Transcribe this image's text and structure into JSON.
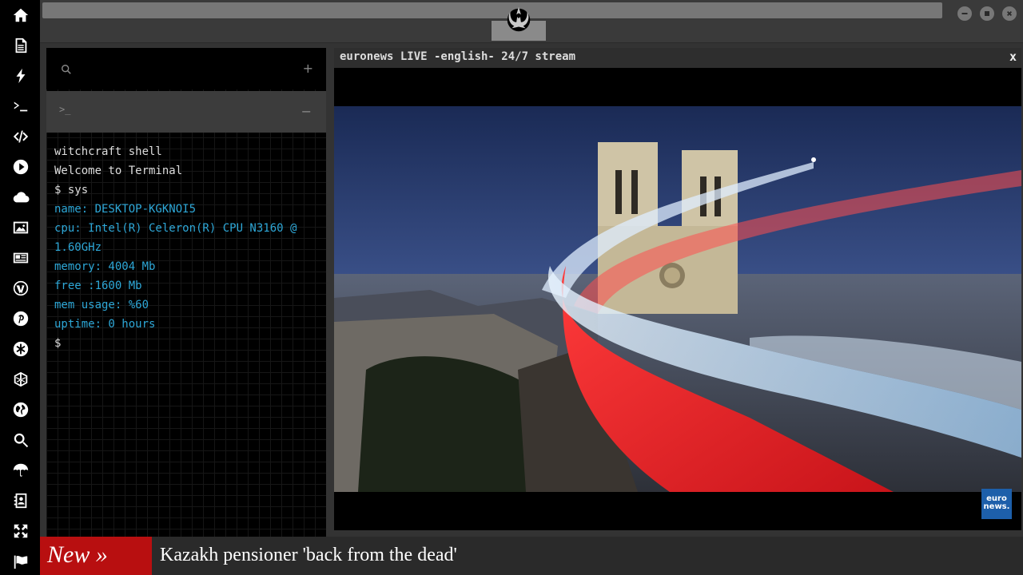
{
  "sidebar": {
    "items": [
      {
        "icon": "home-icon"
      },
      {
        "icon": "document-icon"
      },
      {
        "icon": "lightning-icon"
      },
      {
        "icon": "terminal-icon"
      },
      {
        "icon": "code-icon"
      },
      {
        "icon": "play-icon"
      },
      {
        "icon": "cloud-icon"
      },
      {
        "icon": "image-icon"
      },
      {
        "icon": "newspaper-icon"
      },
      {
        "icon": "wordpress-icon"
      },
      {
        "icon": "pinterest-icon"
      },
      {
        "icon": "snowflake-icon"
      },
      {
        "icon": "globe-mesh-icon"
      },
      {
        "icon": "globe-icon"
      },
      {
        "icon": "search-icon"
      },
      {
        "icon": "umbrella-icon"
      },
      {
        "icon": "contacts-icon"
      },
      {
        "icon": "expand-icon"
      },
      {
        "icon": "flag-icon"
      }
    ]
  },
  "topbar": {
    "logo": "rebel-alliance-icon",
    "buttons": [
      "minimize-icon",
      "maximize-icon",
      "close-icon"
    ]
  },
  "terminal": {
    "search_icon": "search-icon",
    "add_label": "+",
    "tab_prompt": ">_",
    "collapse_label": "−",
    "lines": [
      {
        "text": "witchcraft shell",
        "color": "#dddddd"
      },
      {
        "text": "Welcome to Terminal",
        "color": "#dddddd"
      },
      {
        "text": "$ sys",
        "color": "#dddddd"
      },
      {
        "text": "name: DESKTOP-KGKNOI5",
        "color": "#2ea8d8"
      },
      {
        "text": "cpu: Intel(R) Celeron(R) CPU N3160 @",
        "color": "#2ea8d8"
      },
      {
        "text": "1.60GHz",
        "color": "#2ea8d8"
      },
      {
        "text": "memory: 4004 Mb",
        "color": "#2ea8d8"
      },
      {
        "text": "free :1600 Mb",
        "color": "#2ea8d8"
      },
      {
        "text": "mem usage: %60",
        "color": "#2ea8d8"
      },
      {
        "text": "uptime: 0 hours",
        "color": "#2ea8d8"
      },
      {
        "text": "$",
        "color": "#dddddd"
      }
    ]
  },
  "video": {
    "title": "euronews LIVE -english- 24/7 stream",
    "close_label": "x",
    "badge_line1": "euro",
    "badge_line2": "news."
  },
  "ticker": {
    "label": "New »",
    "headline": "Kazakh pensioner 'back from the dead'",
    "label_color": "#b80f10"
  }
}
